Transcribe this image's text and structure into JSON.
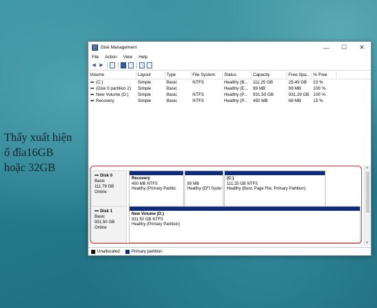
{
  "caption": {
    "line1": "Thấy xuất hiện",
    "line2": "ổ đĩa16GB",
    "line3": "hoặc 32GB"
  },
  "window": {
    "title": "Disk Management",
    "controls": {
      "minimize": "—",
      "maximize": "☐",
      "close": "✕"
    }
  },
  "menu": {
    "file": "File",
    "action": "Action",
    "view": "View",
    "help": "Help"
  },
  "volume_table": {
    "headers": [
      "Volume",
      "Layout",
      "Type",
      "File System",
      "Status",
      "Capacity",
      "Free Spa...",
      "% Free"
    ],
    "rows": [
      [
        "(C:)",
        "Simple",
        "Basic",
        "NTFS",
        "Healthy (B...",
        "111.25 GB",
        "25.49 GB",
        "23 %"
      ],
      [
        "(Disk 0 partition 2)",
        "Simple",
        "Basic",
        "",
        "Healthy (E...",
        "99 MB",
        "99 MB",
        "100 %"
      ],
      [
        "New Volume (D:)",
        "Simple",
        "Basic",
        "NTFS",
        "Healthy (P...",
        "931.50 GB",
        "931.29 GB",
        "100 %"
      ],
      [
        "Recovery",
        "Simple",
        "Basic",
        "NTFS",
        "Healthy (P...",
        "450 MB",
        "68 MB",
        "15 %"
      ]
    ]
  },
  "disks": [
    {
      "name": "Disk 0",
      "type": "Basic",
      "size": "111.79 GB",
      "status": "Online",
      "partitions": [
        {
          "name": "Recovery",
          "detail": "450 MB NTFS",
          "health": "Healthy (Primary Partitic"
        },
        {
          "name": "",
          "detail": "99 MB",
          "health": "Healthy (EFI Syste"
        },
        {
          "name": "(C:)",
          "detail": "111.25 GB NTFS",
          "health": "Healthy (Boot, Page File, Primary Partition)"
        }
      ]
    },
    {
      "name": "Disk 1",
      "type": "Basic",
      "size": "931.50 GB",
      "status": "Online",
      "partitions": [
        {
          "name": "New Volume  (D:)",
          "detail": "931.50 GB NTFS",
          "health": "Healthy (Primary Partition)"
        }
      ]
    }
  ],
  "legend": {
    "unallocated": {
      "label": "Unallocated",
      "color": "#111111"
    },
    "primary": {
      "label": "Primary partition",
      "color": "#102a7a"
    }
  },
  "colors": {
    "highlight": "#e0282e",
    "partition_bar": "#102a7a"
  }
}
